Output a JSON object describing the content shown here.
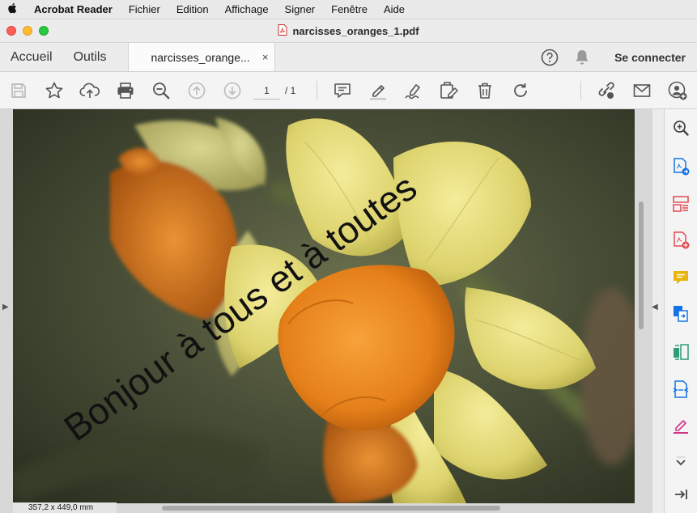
{
  "menubar": {
    "apple": "",
    "app_name": "Acrobat Reader",
    "items": [
      "Fichier",
      "Edition",
      "Affichage",
      "Signer",
      "Fenêtre",
      "Aide"
    ]
  },
  "window": {
    "title": "narcisses_oranges_1.pdf"
  },
  "tabs": {
    "home": "Accueil",
    "tools": "Outils",
    "document": "narcisses_orange...",
    "close": "×",
    "login": "Se connecter"
  },
  "toolbar": {
    "page_current": "1",
    "page_total": "/ 1"
  },
  "document": {
    "overlay_text": "Bonjour à tous et à toutes",
    "page_size": "357,2 x 449,0 mm"
  },
  "colors": {
    "accent_blue": "#1473e6",
    "accent_red": "#e34850",
    "accent_yellow": "#e8b50d",
    "accent_green": "#2d9d78",
    "accent_purple": "#9b3cbe",
    "accent_pink": "#d33682"
  }
}
